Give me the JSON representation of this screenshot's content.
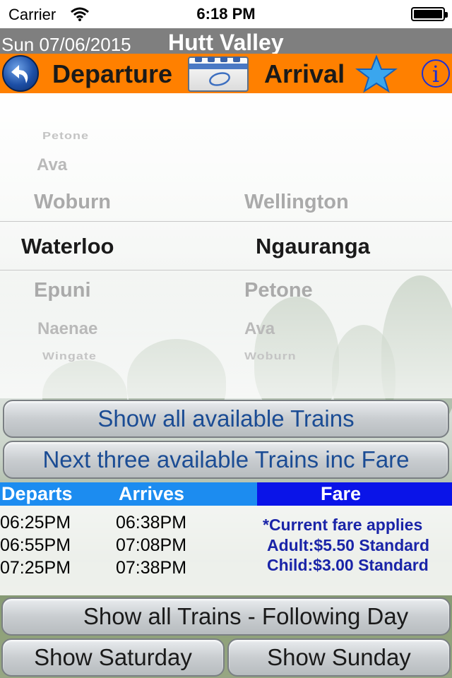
{
  "status_bar": {
    "carrier": "Carrier",
    "time": "6:18 PM"
  },
  "title_bar": {
    "date": "Sun 07/06/2015",
    "region": "Hutt Valley"
  },
  "toolbar": {
    "departure_label": "Departure",
    "arrival_label": "Arrival",
    "info_label": "i",
    "accent_color": "#ff8000"
  },
  "picker": {
    "departure": {
      "above": [
        "Petone",
        "Ava",
        "Woburn"
      ],
      "selected": "Waterloo",
      "below": [
        "Epuni",
        "Naenae",
        "Wingate"
      ]
    },
    "arrival": {
      "above": [
        "Wellington"
      ],
      "selected": "Ngauranga",
      "below": [
        "Petone",
        "Ava",
        "Woburn"
      ]
    }
  },
  "buttons": {
    "show_all": "Show all available Trains",
    "next_three": "Next three available Trains inc Fare",
    "following_day": "Show all Trains - Following Day",
    "saturday": "Show Saturday",
    "sunday": "Show Sunday"
  },
  "results": {
    "headers": {
      "departs": "Departs",
      "arrives": "Arrives",
      "fare": "Fare"
    },
    "rows": [
      {
        "departs": "06:25PM",
        "arrives": "06:38PM"
      },
      {
        "departs": "06:55PM",
        "arrives": "07:08PM"
      },
      {
        "departs": "07:25PM",
        "arrives": "07:38PM"
      }
    ],
    "fare_lines": [
      "*Current fare applies",
      "Adult:$5.50 Standard",
      "Child:$3.00 Standard"
    ]
  }
}
